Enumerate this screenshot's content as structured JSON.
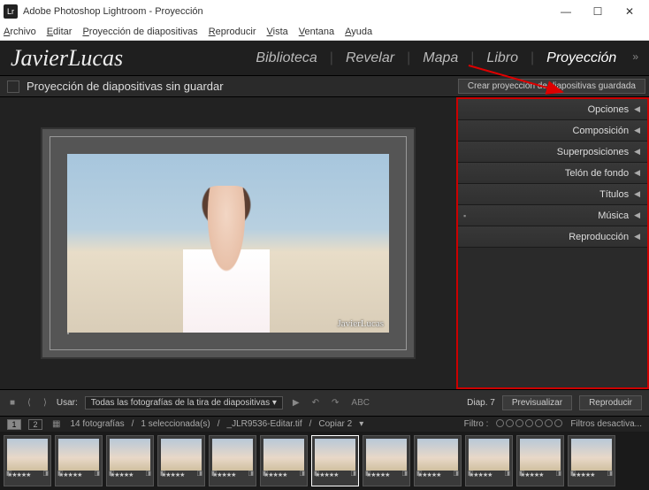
{
  "window": {
    "app_icon": "Lr",
    "title": "Adobe Photoshop Lightroom - Proyección"
  },
  "menu": [
    "Archivo",
    "Editar",
    "Proyección de diapositivas",
    "Reproducir",
    "Vista",
    "Ventana",
    "Ayuda"
  ],
  "identity": "JavierLucas",
  "modules": {
    "items": [
      "Biblioteca",
      "Revelar",
      "Mapa",
      "Libro",
      "Proyección"
    ],
    "active": "Proyección"
  },
  "subheader": {
    "title": "Proyección de diapositivas sin guardar",
    "button": "Crear proyección de diapositivas guardada"
  },
  "watermark": "JavierLucas",
  "panels": [
    "Opciones",
    "Composición",
    "Superposiciones",
    "Telón de fondo",
    "Títulos",
    "Música",
    "Reproducción"
  ],
  "toolbar": {
    "use_label": "Usar:",
    "use_value": "Todas las fotografías de la tira de diapositivas",
    "abc": "ABC",
    "slide_counter": "Diap. 7",
    "preview": "Previsualizar",
    "play": "Reproducir"
  },
  "filterbar": {
    "views": [
      "1",
      "2"
    ],
    "count": "14 fotografías",
    "selection": "1 seleccionada(s)",
    "filename": "_JLR9536-Editar.tif",
    "copy": "Copiar 2",
    "filter_label": "Filtro :",
    "filters_off": "Filtros desactiva..."
  },
  "thumbs": {
    "count": 12,
    "selected_index": 6,
    "stars": "★★★★★"
  }
}
